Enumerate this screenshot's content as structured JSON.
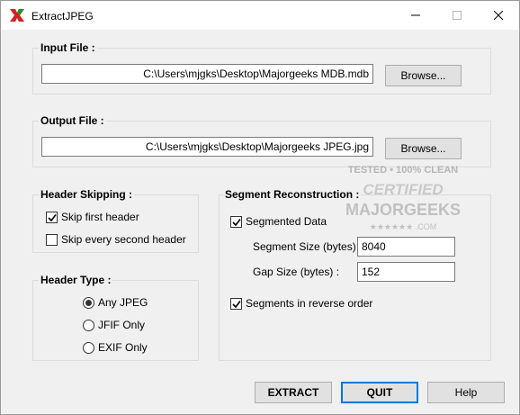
{
  "window": {
    "title": "ExtractJPEG"
  },
  "input_file": {
    "label": "Input File :",
    "path": "C:\\Users\\mjgks\\Desktop\\Majorgeeks MDB.mdb",
    "browse_label": "Browse..."
  },
  "output_file": {
    "label": "Output File :",
    "path": "C:\\Users\\mjgks\\Desktop\\Majorgeeks JPEG.jpg",
    "browse_label": "Browse..."
  },
  "header_skipping": {
    "label": "Header Skipping :",
    "skip_first": {
      "label": "Skip first header",
      "checked": true
    },
    "skip_every_second": {
      "label": "Skip every second header",
      "checked": false
    }
  },
  "header_type": {
    "label": "Header Type :",
    "options": [
      {
        "label": "Any JPEG",
        "selected": true
      },
      {
        "label": "JFIF Only",
        "selected": false
      },
      {
        "label": "EXIF Only",
        "selected": false
      }
    ]
  },
  "segment_reconstruction": {
    "label": "Segment Reconstruction :",
    "segmented_data": {
      "label": "Segmented Data",
      "checked": true
    },
    "segment_size": {
      "label": "Segment Size (bytes) :",
      "value": "8040"
    },
    "gap_size": {
      "label": "Gap Size (bytes) :",
      "value": "152"
    },
    "reverse_order": {
      "label": "Segments in reverse order",
      "checked": true
    }
  },
  "buttons": {
    "extract": "EXTRACT",
    "quit": "QUIT",
    "help": "Help"
  },
  "watermark": {
    "line1": "TESTED • 100% CLEAN",
    "line2": "CERTIFIED",
    "line3": "MAJORGEEKS",
    "line4": "★★★★★★ .COM"
  },
  "colors": {
    "accent": "#0078d7",
    "app_icon_red": "#d42020",
    "app_icon_green": "#2e8b2e"
  }
}
